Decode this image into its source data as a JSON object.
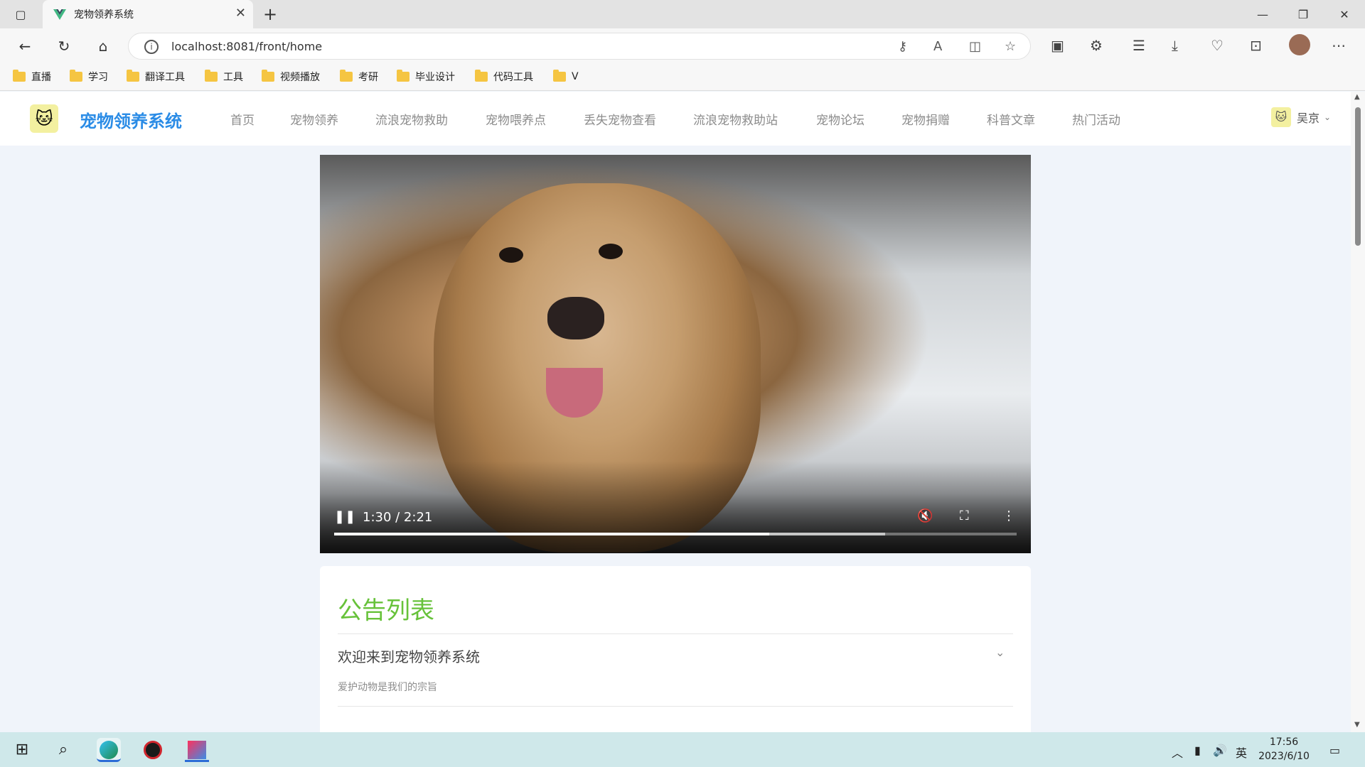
{
  "browser": {
    "tab_title": "宠物领养系统",
    "url": "localhost:8081/front/home",
    "bookmarks": [
      "直播",
      "学习",
      "翻译工具",
      "工具",
      "视频播放",
      "考研",
      "毕业设计",
      "代码工具",
      "V"
    ]
  },
  "site": {
    "title": "宠物领养系统",
    "menu": [
      "首页",
      "宠物领养",
      "流浪宠物救助",
      "宠物喂养点",
      "丢失宠物查看",
      "流浪宠物救助站",
      "宠物论坛",
      "宠物捐赠",
      "科普文章",
      "热门活动"
    ],
    "user": "吴京"
  },
  "video": {
    "time": "1:30 / 2:21",
    "progress": 0.638,
    "buffered": 0.807
  },
  "notice": {
    "heading": "公告列表",
    "items": [
      {
        "title": "欢迎来到宠物领养系统",
        "body": "爱护动物是我们的宗旨"
      }
    ]
  },
  "taskbar": {
    "lang": "英",
    "time": "17:56",
    "date": "2023/6/10"
  },
  "colors": {
    "brand": "#2b8ce6",
    "accent_green": "#67c23a"
  }
}
